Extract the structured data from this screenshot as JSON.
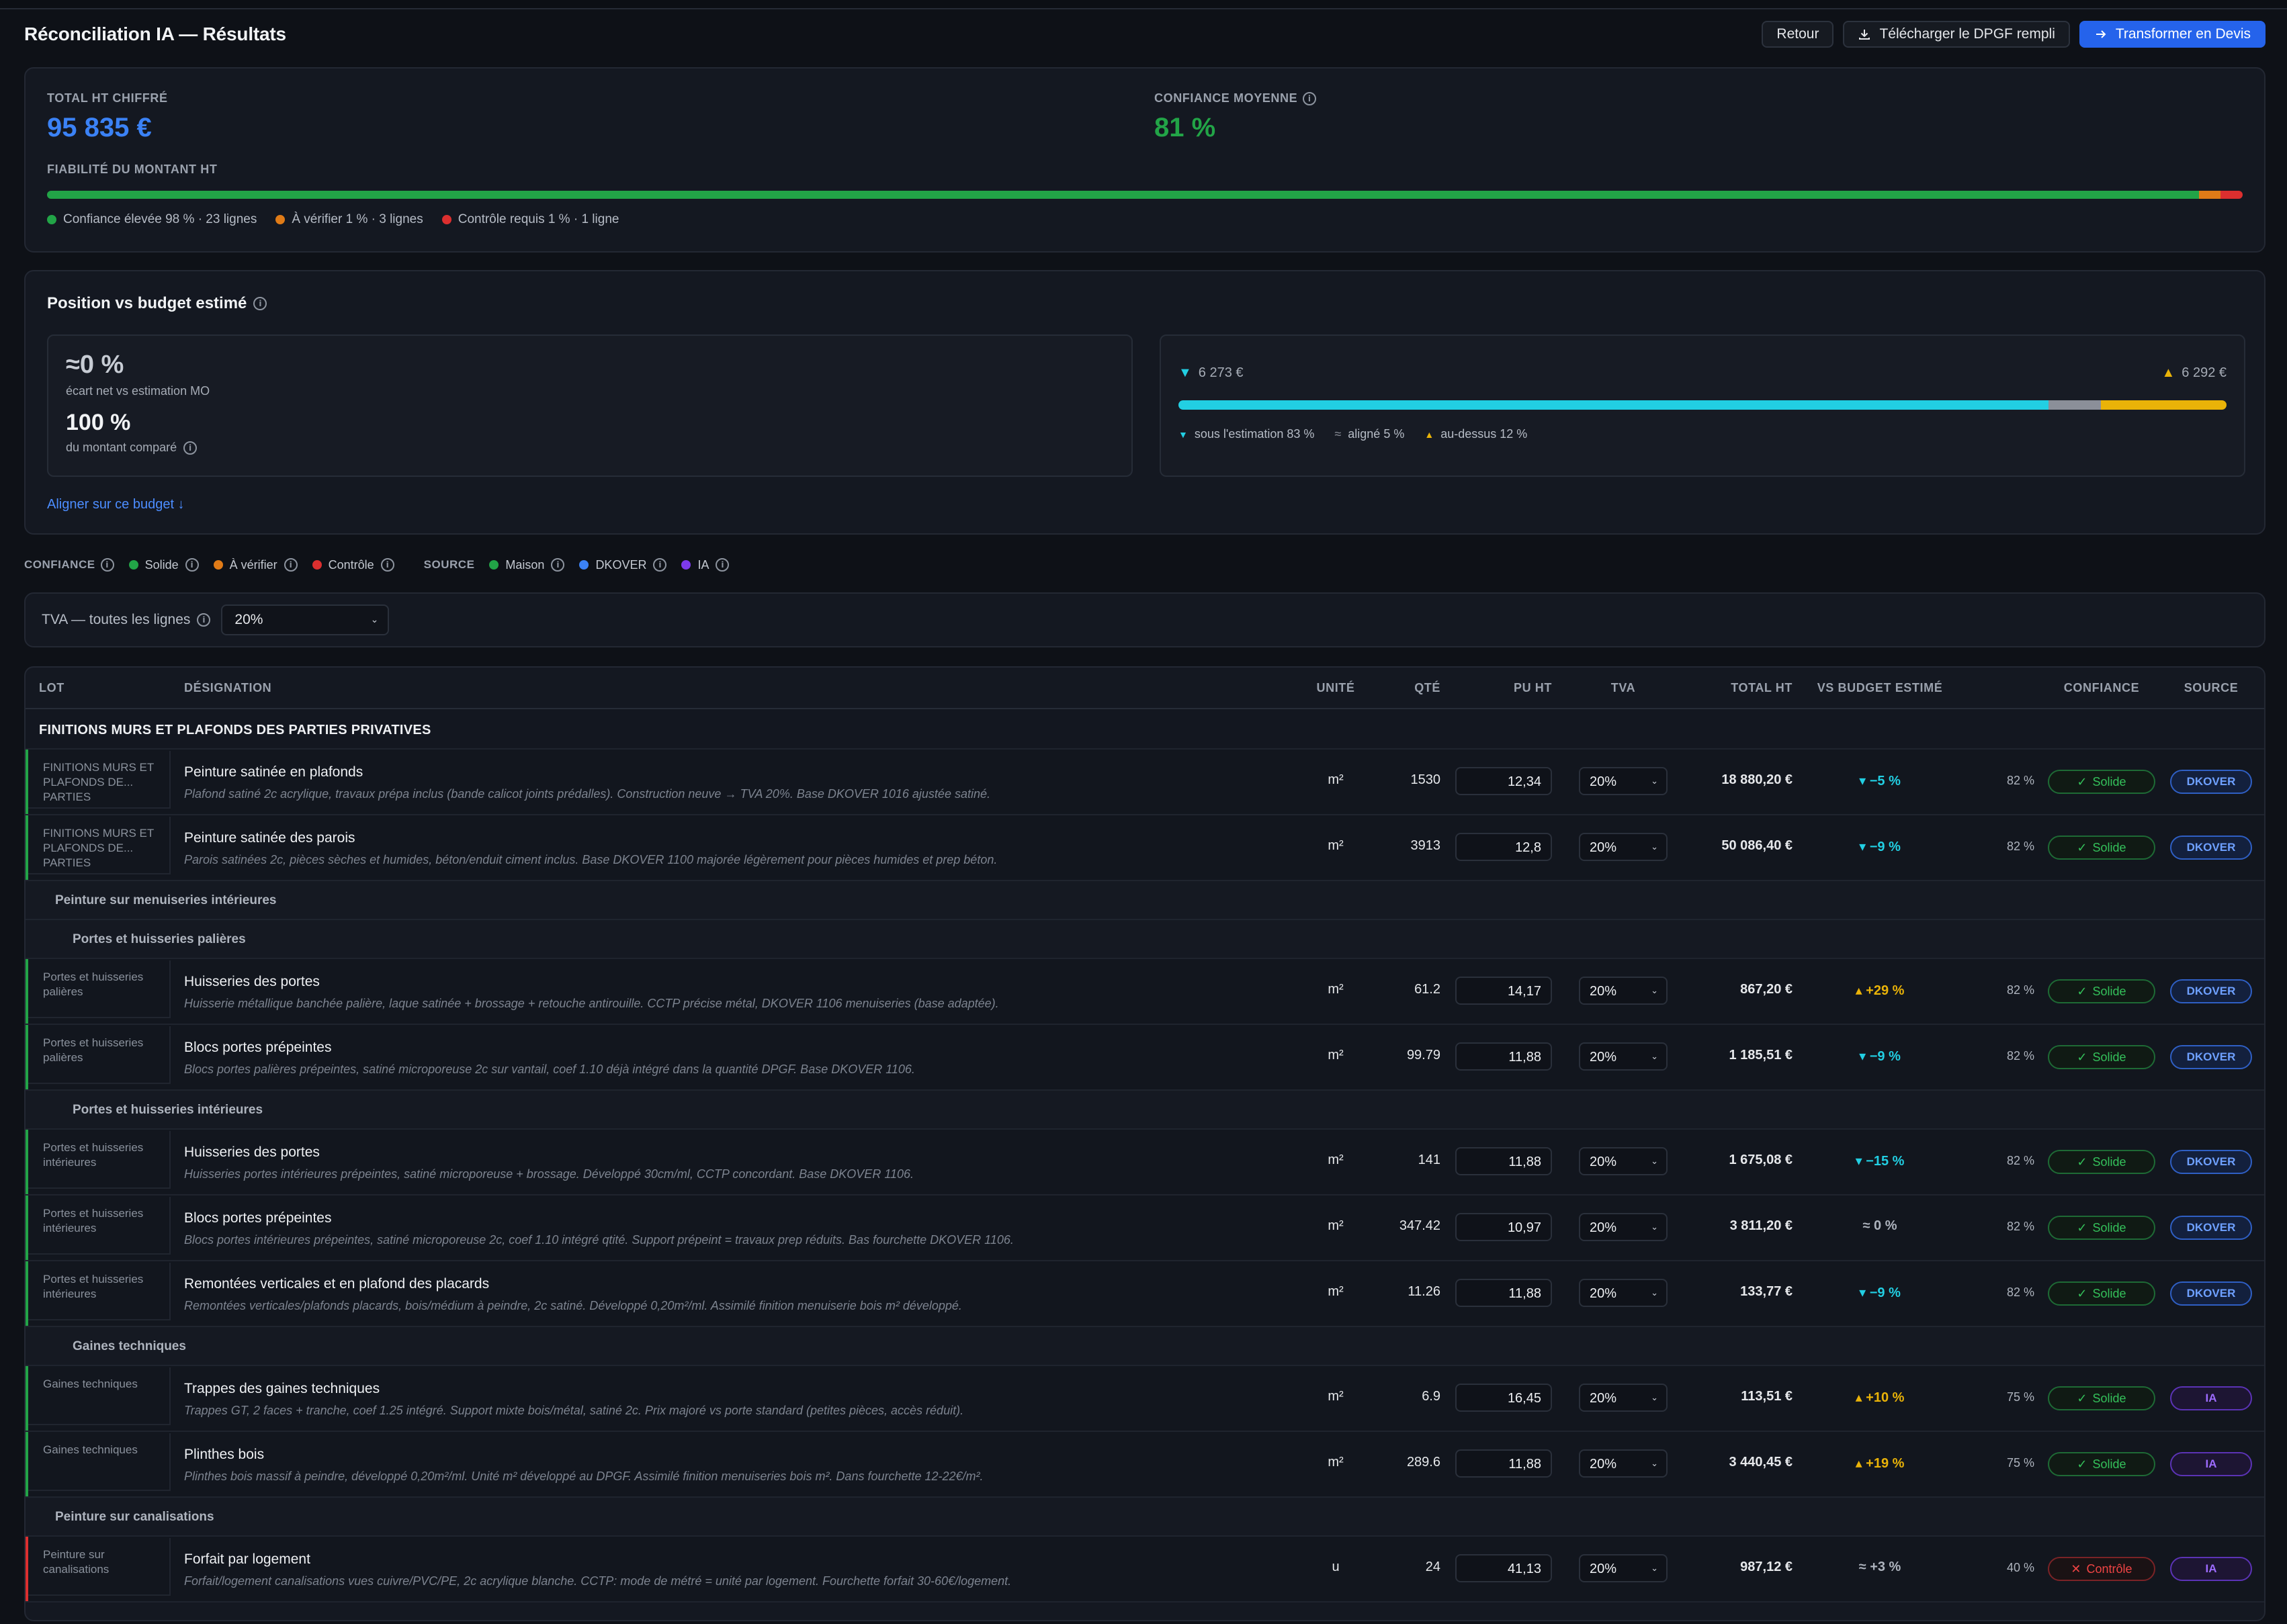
{
  "header": {
    "title": "Réconciliation IA — Résultats",
    "back_label": "Retour",
    "download_label": "Télécharger le DPGF rempli",
    "transform_label": "Transformer en Devis"
  },
  "kpis": {
    "total_label": "TOTAL HT CHIFFRÉ",
    "total_value": "95 835 €",
    "confidence_label": "CONFIANCE MOYENNE",
    "confidence_value": "81 %",
    "reliability_label": "FIABILITÉ DU MONTANT HT",
    "reliability": {
      "high_pct": 98,
      "check_pct": 1,
      "control_pct": 1,
      "legend_high": "Confiance élevée 98 % · 23 lignes",
      "legend_check": "À vérifier 1 % · 3 lignes",
      "legend_control": "Contrôle requis 1 % · 1 ligne"
    }
  },
  "budget": {
    "title": "Position vs budget estimé",
    "net_value": "≈0 %",
    "net_label": "écart net vs estimation MO",
    "compared_value": "100 %",
    "compared_label": "du montant comparé",
    "below_amount": "6 273 €",
    "above_amount": "6 292 €",
    "below_pct": 83,
    "aligned_pct": 5,
    "above_pct": 12,
    "legend_below": "sous l'estimation 83 %",
    "legend_aligned": "aligné 5 %",
    "legend_above": "au-dessus 12 %",
    "align_link": "Aligner sur ce budget ↓"
  },
  "filters": {
    "confidence_label": "CONFIANCE",
    "solid": "Solide",
    "check": "À vérifier",
    "control": "Contrôle",
    "source_label": "SOURCE",
    "maison": "Maison",
    "dkover": "DKOVER",
    "ia": "IA"
  },
  "tva": {
    "label": "TVA — toutes les lignes",
    "value": "20%"
  },
  "table": {
    "columns": {
      "lot": "LOT",
      "designation": "DÉSIGNATION",
      "unit": "UNITÉ",
      "qte": "QTÉ",
      "pu": "PU HT",
      "tva": "TVA",
      "total": "TOTAL HT",
      "vs": "VS BUDGET ESTIMÉ",
      "confidence": "CONFIANCE",
      "source": "SOURCE"
    },
    "group_title": "FINITIONS MURS ET PLAFONDS DES PARTIES PRIVATIVES",
    "sub_menuiseries": "Peinture sur menuiseries intérieures",
    "sub_paliers": "Portes et huisseries palières",
    "sub_interieures": "Portes et huisseries intérieures",
    "sub_gaines": "Gaines techniques",
    "sub_canalisations": "Peinture sur canalisations",
    "rows": [
      {
        "lot": "FINITIONS MURS ET PLAFONDS DE... PARTIES",
        "name": "Peinture satinée en plafonds",
        "desc": "Plafond satiné 2c acrylique, travaux prépa inclus (bande calicot joints prédalles). Construction neuve → TVA 20%. Base DKOVER 1016 ajustée satiné.",
        "unit": "m²",
        "qte": "1530",
        "pu": "12,34",
        "tva": "20%",
        "total": "18 880,20 €",
        "vs": "▾ −5 %",
        "pct": "82 %",
        "conf": "Solide",
        "source": "DKOVER"
      },
      {
        "lot": "FINITIONS MURS ET PLAFONDS DE... PARTIES",
        "name": "Peinture satinée des parois",
        "desc": "Parois satinées 2c, pièces sèches et humides, béton/enduit ciment inclus. Base DKOVER 1100 majorée légèrement pour pièces humides et prep béton.",
        "unit": "m²",
        "qte": "3913",
        "pu": "12,8",
        "tva": "20%",
        "total": "50 086,40 €",
        "vs": "▾ −9 %",
        "pct": "82 %",
        "conf": "Solide",
        "source": "DKOVER"
      },
      {
        "lot": "Portes et huisseries palières",
        "name": "Huisseries des portes",
        "desc": "Huisserie métallique banchée palière, laque satinée + brossage + retouche antirouille. CCTP précise métal, DKOVER 1106 menuiseries (base adaptée).",
        "unit": "m²",
        "qte": "61.2",
        "pu": "14,17",
        "tva": "20%",
        "total": "867,20 €",
        "vs": "▴ +29 %",
        "pct": "82 %",
        "conf": "Solide",
        "source": "DKOVER"
      },
      {
        "lot": "Portes et huisseries palières",
        "name": "Blocs portes prépeintes",
        "desc": "Blocs portes palières prépeintes, satiné microporeuse 2c sur vantail, coef 1.10 déjà intégré dans la quantité DPGF. Base DKOVER 1106.",
        "unit": "m²",
        "qte": "99.79",
        "pu": "11,88",
        "tva": "20%",
        "total": "1 185,51 €",
        "vs": "▾ −9 %",
        "pct": "82 %",
        "conf": "Solide",
        "source": "DKOVER"
      },
      {
        "lot": "Portes et huisseries intérieures",
        "name": "Huisseries des portes",
        "desc": "Huisseries portes intérieures prépeintes, satiné microporeuse + brossage. Développé 30cm/ml, CCTP concordant. Base DKOVER 1106.",
        "unit": "m²",
        "qte": "141",
        "pu": "11,88",
        "tva": "20%",
        "total": "1 675,08 €",
        "vs": "▾ −15 %",
        "pct": "82 %",
        "conf": "Solide",
        "source": "DKOVER"
      },
      {
        "lot": "Portes et huisseries intérieures",
        "name": "Blocs portes prépeintes",
        "desc": "Blocs portes intérieures prépeintes, satiné microporeuse 2c, coef 1.10 intégré qtité. Support prépeint = travaux prep réduits. Bas fourchette DKOVER 1106.",
        "unit": "m²",
        "qte": "347.42",
        "pu": "10,97",
        "tva": "20%",
        "total": "3 811,20 €",
        "vs": "≈ 0 %",
        "pct": "82 %",
        "conf": "Solide",
        "source": "DKOVER"
      },
      {
        "lot": "Portes et huisseries intérieures",
        "name": "Remontées verticales et en plafond des placards",
        "desc": "Remontées verticales/plafonds placards, bois/médium à peindre, 2c satiné. Développé 0,20m²/ml. Assimilé finition menuiserie bois m² développé.",
        "unit": "m²",
        "qte": "11.26",
        "pu": "11,88",
        "tva": "20%",
        "total": "133,77 €",
        "vs": "▾ −9 %",
        "pct": "82 %",
        "conf": "Solide",
        "source": "DKOVER"
      },
      {
        "lot": "Gaines techniques",
        "name": "Trappes des gaines techniques",
        "desc": "Trappes GT, 2 faces + tranche, coef 1.25 intégré. Support mixte bois/métal, satiné 2c. Prix majoré vs porte standard (petites pièces, accès réduit).",
        "unit": "m²",
        "qte": "6.9",
        "pu": "16,45",
        "tva": "20%",
        "total": "113,51 €",
        "vs": "▴ +10 %",
        "pct": "75 %",
        "conf": "Solide",
        "source": "IA"
      },
      {
        "lot": "Gaines techniques",
        "name": "Plinthes bois",
        "desc": "Plinthes bois massif à peindre, développé 0,20m²/ml. Unité m² développé au DPGF. Assimilé finition menuiseries bois m². Dans fourchette 12-22€/m².",
        "unit": "m²",
        "qte": "289.6",
        "pu": "11,88",
        "tva": "20%",
        "total": "3 440,45 €",
        "vs": "▴ +19 %",
        "pct": "75 %",
        "conf": "Solide",
        "source": "IA"
      },
      {
        "lot": "Peinture sur canalisations",
        "name": "Forfait par logement",
        "desc": "Forfait/logement canalisations vues cuivre/PVC/PE, 2c acrylique blanche. CCTP: mode de métré = unité par logement. Fourchette forfait 30-60€/logement.",
        "unit": "u",
        "qte": "24",
        "pu": "41,13",
        "tva": "20%",
        "total": "987,12 €",
        "vs": "≈ +3 %",
        "pct": "40 %",
        "conf": "Contrôle",
        "source": "IA"
      }
    ]
  },
  "colors": {
    "green": "#22a447",
    "orange": "#e07b17",
    "red": "#dc2f2f",
    "blue": "#2563eb",
    "cyan": "#22cfe3",
    "gray": "#8b8f99",
    "amber": "#eab308",
    "purple": "#7c3aed"
  }
}
